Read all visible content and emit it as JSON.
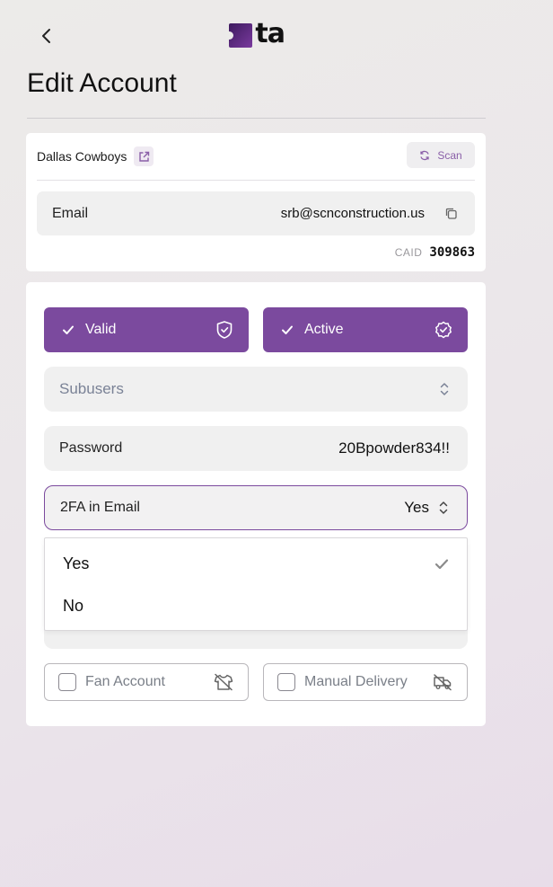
{
  "header": {
    "logo_text": "ta",
    "title": "Edit Account"
  },
  "account": {
    "team_name": "Dallas Cowboys",
    "scan_label": "Scan",
    "email_label": "Email",
    "email_value": "srb@scnconstruction.us",
    "caid_label": "CAID",
    "caid_value": "309863"
  },
  "status": {
    "valid_label": "Valid",
    "active_label": "Active"
  },
  "fields": {
    "subusers_placeholder": "Subusers",
    "password_label": "Password",
    "password_value": "20Bpowder834!!",
    "twofa_label": "2FA in Email",
    "twofa_value": "Yes"
  },
  "dropdown": {
    "options": [
      "Yes",
      "No"
    ],
    "selected": "Yes"
  },
  "checkboxes": {
    "fan_label": "Fan Account",
    "manual_label": "Manual Delivery"
  },
  "colors": {
    "accent": "#7b4a9e",
    "scan_text": "#8a5fa8"
  }
}
